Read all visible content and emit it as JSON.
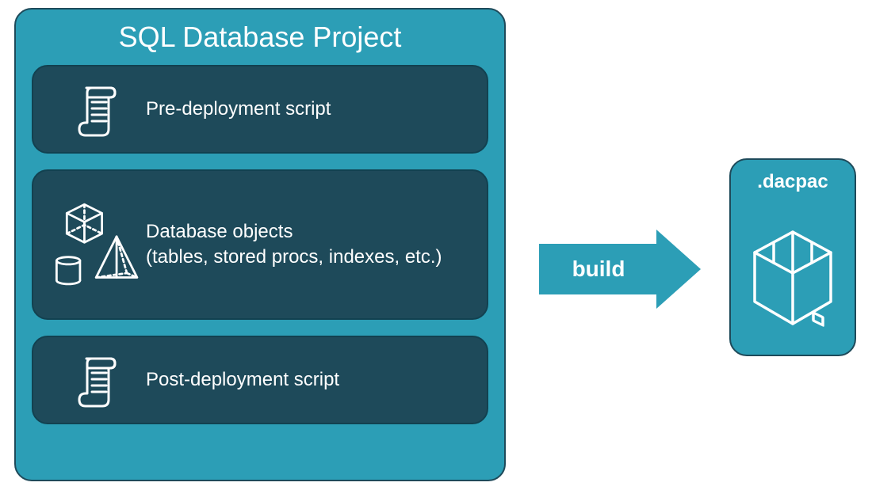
{
  "project": {
    "title": "SQL Database Project",
    "cards": [
      {
        "label": "Pre-deployment script"
      },
      {
        "label_line1": "Database objects",
        "label_line2": "(tables, stored procs, indexes, etc.)"
      },
      {
        "label": "Post-deployment script"
      }
    ]
  },
  "arrow": {
    "label": "build"
  },
  "output": {
    "label": ".dacpac"
  },
  "colors": {
    "teal": "#2c9eb6",
    "darkTeal": "#1e4a5a",
    "white": "#ffffff"
  }
}
